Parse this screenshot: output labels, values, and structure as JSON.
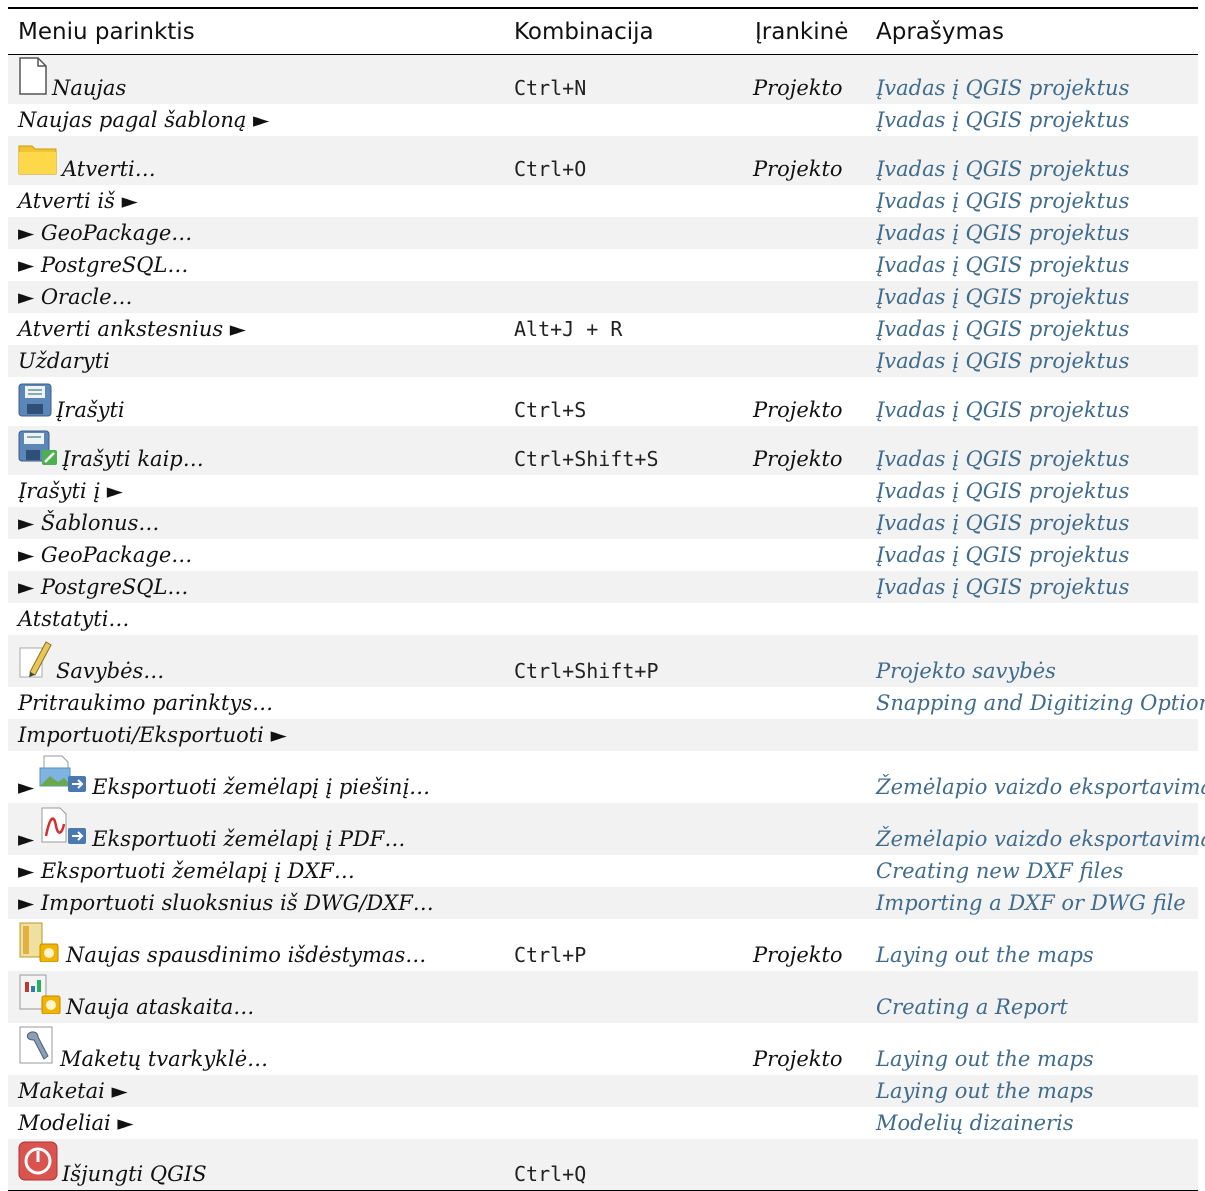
{
  "headers": [
    "Meniu parinktis",
    "Kombinacija",
    "Įrankinė",
    "Aprašymas"
  ],
  "rows": [
    {
      "label": "Naujas",
      "icon": "new-file-icon",
      "shortcut": "Ctrl+N",
      "toolbar": "Projekto",
      "desc": "Įvadas į QGIS projektus"
    },
    {
      "label": "Naujas pagal šabloną ►",
      "icon": "",
      "shortcut": "",
      "toolbar": "",
      "desc": "Įvadas į QGIS projektus"
    },
    {
      "label": "Atverti…",
      "icon": "folder-icon",
      "shortcut": "Ctrl+O",
      "toolbar": "Projekto",
      "desc": "Įvadas į QGIS projektus"
    },
    {
      "label": "Atverti iš ►",
      "icon": "",
      "shortcut": "",
      "toolbar": "",
      "desc": "Įvadas į QGIS projektus"
    },
    {
      "label": "► GeoPackage…",
      "icon": "",
      "shortcut": "",
      "toolbar": "",
      "desc": "Įvadas į QGIS projektus"
    },
    {
      "label": "► PostgreSQL…",
      "icon": "",
      "shortcut": "",
      "toolbar": "",
      "desc": "Įvadas į QGIS projektus"
    },
    {
      "label": "► Oracle…",
      "icon": "",
      "shortcut": "",
      "toolbar": "",
      "desc": "Įvadas į QGIS projektus"
    },
    {
      "label": "Atverti ankstesnius ►",
      "icon": "",
      "shortcut": "Alt+J + R",
      "toolbar": "",
      "desc": "Įvadas į QGIS projektus"
    },
    {
      "label": "Uždaryti",
      "icon": "",
      "shortcut": "",
      "toolbar": "",
      "desc": "Įvadas į QGIS projektus"
    },
    {
      "label": "Įrašyti",
      "icon": "save-icon",
      "shortcut": "Ctrl+S",
      "toolbar": "Projekto",
      "desc": "Įvadas į QGIS projektus"
    },
    {
      "label": "Įrašyti kaip…",
      "icon": "save-as-icon",
      "shortcut": "Ctrl+Shift+S",
      "toolbar": "Projekto",
      "desc": "Įvadas į QGIS projektus"
    },
    {
      "label": "Įrašyti į ►",
      "icon": "",
      "shortcut": "",
      "toolbar": "",
      "desc": "Įvadas į QGIS projektus"
    },
    {
      "label": "► Šablonus…",
      "icon": "",
      "shortcut": "",
      "toolbar": "",
      "desc": "Įvadas į QGIS projektus"
    },
    {
      "label": "► GeoPackage…",
      "icon": "",
      "shortcut": "",
      "toolbar": "",
      "desc": "Įvadas į QGIS projektus"
    },
    {
      "label": "► PostgreSQL…",
      "icon": "",
      "shortcut": "",
      "toolbar": "",
      "desc": "Įvadas į QGIS projektus"
    },
    {
      "label": "Atstatyti…",
      "icon": "",
      "shortcut": "",
      "toolbar": "",
      "desc": ""
    },
    {
      "label": "Savybės…",
      "icon": "pencil-icon",
      "shortcut": "Ctrl+Shift+P",
      "toolbar": "",
      "desc": "Projekto savybės"
    },
    {
      "label": "Pritraukimo parinktys…",
      "icon": "",
      "shortcut": "",
      "toolbar": "",
      "desc": "Snapping and Digitizing Options"
    },
    {
      "label": "Importuoti/Eksportuoti ►",
      "icon": "",
      "shortcut": "",
      "toolbar": "",
      "desc": ""
    },
    {
      "label": "Eksportuoti žemėlapį į piešinį…",
      "prefix": "►",
      "icon": "export-image-icon",
      "shortcut": "",
      "toolbar": "",
      "desc": "Žemėlapio vaizdo eksportavimas"
    },
    {
      "label": "Eksportuoti žemėlapį į PDF…",
      "prefix": "►",
      "icon": "export-pdf-icon",
      "shortcut": "",
      "toolbar": "",
      "desc": "Žemėlapio vaizdo eksportavimas"
    },
    {
      "label": "► Eksportuoti žemėlapį į DXF…",
      "icon": "",
      "shortcut": "",
      "toolbar": "",
      "desc": "Creating new DXF files"
    },
    {
      "label": "► Importuoti sluoksnius iš DWG/DXF…",
      "icon": "",
      "shortcut": "",
      "toolbar": "",
      "desc": "Importing a DXF or DWG file"
    },
    {
      "label": "Naujas spausdinimo išdėstymas…",
      "icon": "new-layout-icon",
      "shortcut": "Ctrl+P",
      "toolbar": "Projekto",
      "desc": "Laying out the maps"
    },
    {
      "label": "Nauja ataskaita…",
      "icon": "new-report-icon",
      "shortcut": "",
      "toolbar": "",
      "desc": "Creating a Report"
    },
    {
      "label": "Maketų tvarkyklė…",
      "icon": "layout-manager-icon",
      "shortcut": "",
      "toolbar": "Projekto",
      "desc": "Laying out the maps"
    },
    {
      "label": "Maketai ►",
      "icon": "",
      "shortcut": "",
      "toolbar": "",
      "desc": "Laying out the maps"
    },
    {
      "label": "Modeliai ►",
      "icon": "",
      "shortcut": "",
      "toolbar": "",
      "desc": "Modelių dizaineris"
    },
    {
      "label": "Išjungti QGIS",
      "icon": "exit-icon",
      "shortcut": "Ctrl+Q",
      "toolbar": "",
      "desc": ""
    }
  ]
}
